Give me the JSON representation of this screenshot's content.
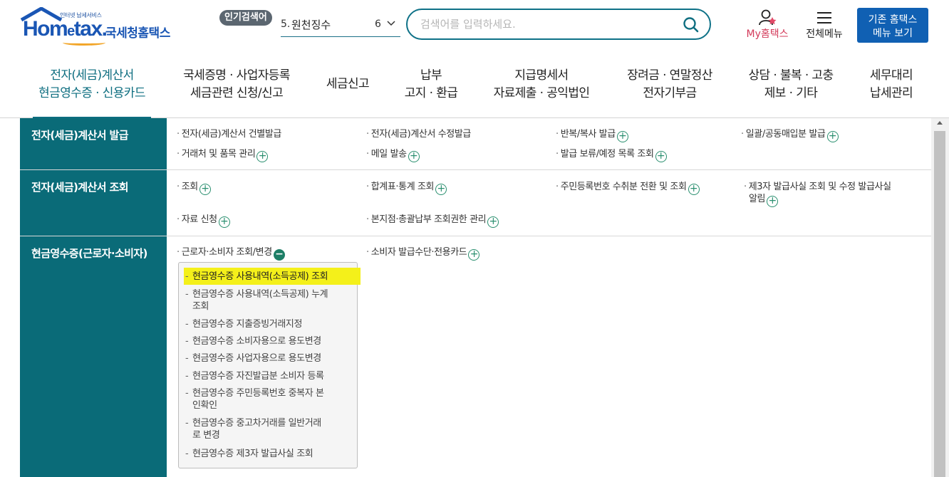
{
  "header": {
    "logo_tagline": "인터넷 납세서비스",
    "logo_wordmark_a": "Hom",
    "logo_wordmark_e": "e",
    "logo_wordmark_b": "tax.",
    "logo_name": "국세청홈택스",
    "popular_badge": "인기검색어",
    "popular_rank": "5.",
    "popular_term": "원천징수",
    "popular_next": "6",
    "search_placeholder": "검색어를 입력하세요.",
    "my_label": "My홈택스",
    "allmenu_label": "전체메뉴",
    "legacy_line1": "기존 홈택스",
    "legacy_line2": "메뉴 보기"
  },
  "gnb": [
    {
      "line1": "전자(세금)계산서",
      "line2": "현금영수증 · 신용카드"
    },
    {
      "line1": "국세증명 · 사업자등록",
      "line2": "세금관련 신청/신고"
    },
    {
      "line1": "세금신고",
      "line2": ""
    },
    {
      "line1": "납부",
      "line2": "고지 · 환급"
    },
    {
      "line1": "지급명세서",
      "line2": "자료제출 · 공익법인"
    },
    {
      "line1": "장려금 · 연말정산",
      "line2": "전자기부금"
    },
    {
      "line1": "상담 · 불복 · 고충",
      "line2": "제보 · 기타"
    },
    {
      "line1": "세무대리",
      "line2": "납세관리"
    }
  ],
  "rows": [
    {
      "title": "전자(세금)계산서 발급",
      "links": [
        "전자(세금)계산서 건별발급",
        "전자(세금)계산서 수정발급",
        "반복/복사 발급",
        "일괄/공동매입분 발급",
        "거래처 및 품목 관리",
        "메일 발송",
        "발급 보류/예정 목록 조회"
      ]
    },
    {
      "title": "전자(세금)계산서 조회",
      "links": [
        "조회",
        "합계표·통계 조회",
        "주민등록번호 수취분 전환 및 조회",
        "제3자 발급사실 조회 및 수정 발급사실",
        "알림",
        "자료 신청",
        "본지점·총괄납부 조회권한 관리"
      ]
    },
    {
      "title": "현금영수증(근로자·소비자)",
      "links": [
        "근로자·소비자 조회/변경",
        "소비자 발급수단·전용카드"
      ]
    }
  ],
  "submenu": [
    "현금영수증 사용내역(소득공제) 조회",
    "현금영수증 사용내역(소득공제) 누계",
    "조회",
    "현금영수증 지출증빙거래지정",
    "현금영수증 소비자용으로 용도변경",
    "현금영수증 사업자용으로 용도변경",
    "현금영수증 자진발급분 소비자 등록",
    "현금영수증 주민등록번호 중복자 본",
    "인확인",
    "현금영수증 중고차거래를 일반거래",
    "로 변경",
    "현금영수증 제3자 발급사실 조회"
  ],
  "colors": {
    "accent": "#0a6b78",
    "highlight": "#f4f01a",
    "brand": "#1a56b4"
  }
}
